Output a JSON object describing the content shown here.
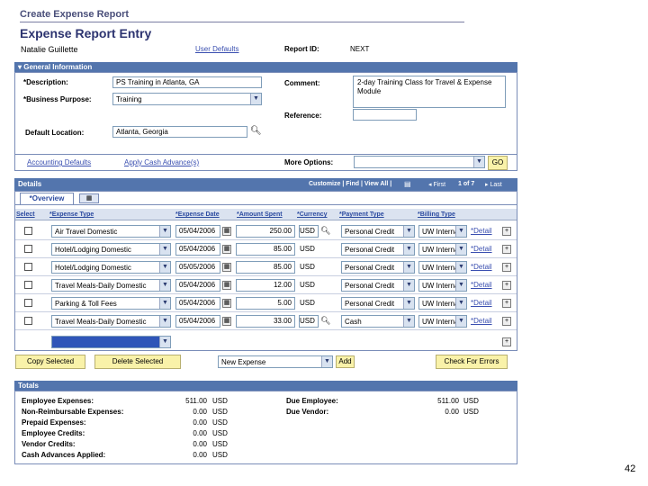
{
  "breadcrumb": "Create Expense Report",
  "page_title": "Expense Report Entry",
  "employee_name": "Natalie Guillette",
  "user_defaults_link": "User Defaults",
  "report_id_label": "Report ID:",
  "report_id_value": "NEXT",
  "general_info": {
    "header": "General Information",
    "description_label": "*Description:",
    "description_value": "PS Training in Atlanta, GA",
    "business_purpose_label": "*Business Purpose:",
    "business_purpose_value": "Training",
    "default_location_label": "Default Location:",
    "default_location_value": "Atlanta, Georgia",
    "comment_label": "Comment:",
    "comment_value": "2-day Training Class for Travel & Expense Module",
    "reference_label": "Reference:",
    "reference_value": "",
    "accounting_defaults_link": "Accounting Defaults",
    "apply_cash_advance_link": "Apply Cash Advance(s)",
    "more_options_label": "More Options:",
    "more_options_value": "",
    "go_button": "GO"
  },
  "details": {
    "header": "Details",
    "nav": "Customize | Find | View All |",
    "first": "First",
    "pager": "1 of 7",
    "last": "Last",
    "tab_overview": "*Overview",
    "columns": [
      "Select",
      "*Expense Type",
      "*Expense Date",
      "*Amount Spent",
      "*Currency",
      "*Payment Type",
      "*Billing Type"
    ],
    "rows": [
      {
        "type": "Air Travel Domestic",
        "date": "05/04/2006",
        "amount": "250.00",
        "currency": "USD",
        "payment": "Personal Credit",
        "billing": "UW Internal",
        "detail": "*Detail"
      },
      {
        "type": "Hotel/Lodging Domestic",
        "date": "05/04/2006",
        "amount": "85.00",
        "currency": "USD",
        "payment": "Personal Credit",
        "billing": "UW Internal",
        "detail": "*Detail"
      },
      {
        "type": "Hotel/Lodging Domestic",
        "date": "05/05/2006",
        "amount": "85.00",
        "currency": "USD",
        "payment": "Personal Credit",
        "billing": "UW Internal",
        "detail": "*Detail"
      },
      {
        "type": "Travel Meals-Daily Domestic",
        "date": "05/04/2006",
        "amount": "12.00",
        "currency": "USD",
        "payment": "Personal Credit",
        "billing": "UW Internal",
        "detail": "*Detail"
      },
      {
        "type": "Parking & Toll Fees",
        "date": "05/04/2006",
        "amount": "5.00",
        "currency": "USD",
        "payment": "Personal Credit",
        "billing": "UW Internal",
        "detail": "*Detail"
      },
      {
        "type": "Travel Meals-Daily Domestic",
        "date": "05/04/2006",
        "amount": "33.00",
        "currency": "USD",
        "payment": "Cash",
        "billing": "UW Internal",
        "detail": "*Detail"
      }
    ],
    "copy_selected": "Copy Selected",
    "delete_selected": "Delete Selected",
    "new_expense": "New Expense",
    "add_button": "Add",
    "check_errors": "Check For Errors"
  },
  "totals": {
    "header": "Totals",
    "left": [
      {
        "label": "Employee Expenses:",
        "value": "511.00",
        "currency": "USD"
      },
      {
        "label": "Non-Reimbursable Expenses:",
        "value": "0.00",
        "currency": "USD"
      },
      {
        "label": "Prepaid Expenses:",
        "value": "0.00",
        "currency": "USD"
      },
      {
        "label": "Employee Credits:",
        "value": "0.00",
        "currency": "USD"
      },
      {
        "label": "Vendor Credits:",
        "value": "0.00",
        "currency": "USD"
      },
      {
        "label": "Cash Advances Applied:",
        "value": "0.00",
        "currency": "USD"
      }
    ],
    "right": [
      {
        "label": "Due Employee:",
        "value": "511.00",
        "currency": "USD"
      },
      {
        "label": "Due Vendor:",
        "value": "0.00",
        "currency": "USD"
      }
    ]
  },
  "slide_number": "42",
  "colors": {
    "header_bar": "#5375ad",
    "button": "#f9f2a9",
    "link": "#3a4fb0"
  }
}
